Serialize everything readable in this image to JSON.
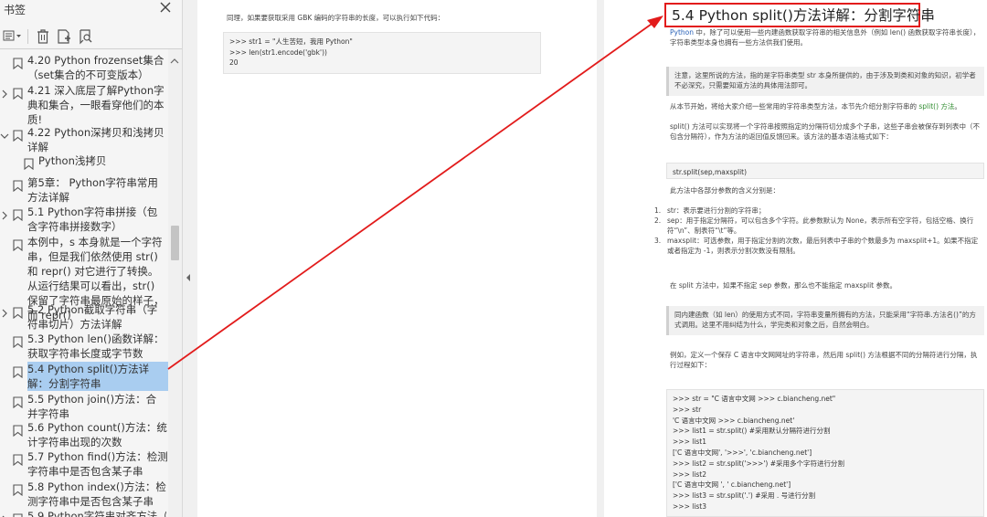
{
  "sidebar": {
    "title": "书签",
    "close_label": "✕",
    "toolbar": {
      "view_label": "▾"
    },
    "items": [
      {
        "text": "4.20 Python frozenset集合（set集合的不可变版本）",
        "expandable": false
      },
      {
        "text": "4.21 深入底层了解Python字典和集合，一眼看穿他们的本质!",
        "expandable": true
      },
      {
        "text": "4.22 Python深拷贝和浅拷贝详解",
        "expandable": true,
        "expanded": true
      },
      {
        "text": "Python浅拷贝",
        "expandable": false
      },
      {
        "text": "第5章： Python字符串常用方法详解",
        "expandable": false
      },
      {
        "text": "5.1 Python字符串拼接（包含字符串拼接数字）",
        "expandable": true
      },
      {
        "text": "本例中，s 本身就是一个字符串，但是我们依然使用 str() 和 repr() 对它进行了转换。从运行结果可以看出，str() 保留了字符串最原始的样子，而 repr()",
        "expandable": false
      },
      {
        "text": "5.2 Python截取字符串（字符串切片）方法详解",
        "expandable": true
      },
      {
        "text": "5.3 Python len()函数详解：获取字符串长度或字节数",
        "expandable": false
      },
      {
        "text": "5.4 Python split()方法详解：分割字符串",
        "expandable": false,
        "selected": true
      },
      {
        "text": "5.5 Python join()方法：合并字符串",
        "expandable": false
      },
      {
        "text": "5.6 Python count()方法：统计字符串出现的次数",
        "expandable": false
      },
      {
        "text": "5.7 Python find()方法：检测字符串中是否包含某子串",
        "expandable": false
      },
      {
        "text": "5.8 Python index()方法：检测字符串中是否包含某子串",
        "expandable": false
      },
      {
        "text": "5.9 Python字符串对齐方法（",
        "expandable": true
      }
    ]
  },
  "page1": {
    "intro": "同理，如果要获取采用 GBK 编码的字符串的长度，可以执行如下代码：",
    "code": [
      ">>> str1 = \"人生苦短，我用 Python\"",
      ">>> len(str1.encode('gbk'))",
      "20"
    ]
  },
  "page2": {
    "title": "5.4 Python split()方法详解：分割字符串",
    "intro_lead": "Python",
    "intro": " 中，除了可以使用一些内建函数获取字符串的相关信息外（例如 len() 函数获取字符串长度），字符串类型本身也拥有一些方法供我们使用。",
    "note1": "注意，这里所说的方法，指的是字符串类型 str 本身所提供的，由于涉及到类和对象的知识，初学者不必深究，只需要知道方法的具体用法即可。",
    "para1_a": "从本节开始，将给大家介绍一些常用的字符串类型方法，本节先介绍分割字符串的 ",
    "para1_b": "split() 方法",
    "para1_c": "。",
    "para2": "split() 方法可以实现将一个字符串按照指定的分隔符切分成多个子串，这些子串会被保存到列表中（不包含分隔符），作为方法的返回值反馈回来。该方法的基本语法格式如下：",
    "syntax": "str.split(sep,maxsplit)",
    "para3": "此方法中各部分参数的含义分别是：",
    "params": [
      {
        "num": "1.",
        "text": "str：表示要进行分割的字符串；"
      },
      {
        "num": "2.",
        "text": "sep：用于指定分隔符，可以包含多个字符。此参数默认为 None，表示所有空字符，包括空格、换行符“\\n”、制表符“\\t”等。"
      },
      {
        "num": "3.",
        "text": "maxsplit：可选参数，用于指定分割的次数，最后列表中子串的个数最多为 maxsplit+1。如果不指定或者指定为 -1，则表示分割次数没有限制。"
      }
    ],
    "para4": "在 split 方法中，如果不指定 sep 参数，那么也不能指定 maxsplit 参数。",
    "note2": "同内建函数（如 len）的使用方式不同，字符串变量所拥有的方法，只能采用“字符串.方法名()”的方式调用。这里不用纠结为什么，学完类和对象之后，自然会明白。",
    "para5": "例如，定义一个保存 C 语言中文网网址的字符串，然后用 split() 方法根据不同的分隔符进行分隔，执行过程如下：",
    "code2": [
      ">>> str = \"C 语言中文网 >>> c.biancheng.net\"",
      ">>> str",
      "'C 语言中文网 >>> c.biancheng.net'",
      ">>> list1 = str.split() #采用默认分隔符进行分割",
      ">>> list1",
      "['C 语言中文网', '>>>', 'c.biancheng.net']",
      ">>> list2 = str.split('>>>') #采用多个字符进行分割",
      ">>> list2",
      "['C 语言中文网 ', ' c.biancheng.net']",
      ">>> list3 = str.split('.') #采用 . 号进行分割",
      ">>> list3"
    ]
  },
  "colors": {
    "highlight": "#a9cdf0",
    "annotation_red": "#e21b1b",
    "link_blue": "#2a62b8",
    "link_green": "#2e8b2e"
  }
}
